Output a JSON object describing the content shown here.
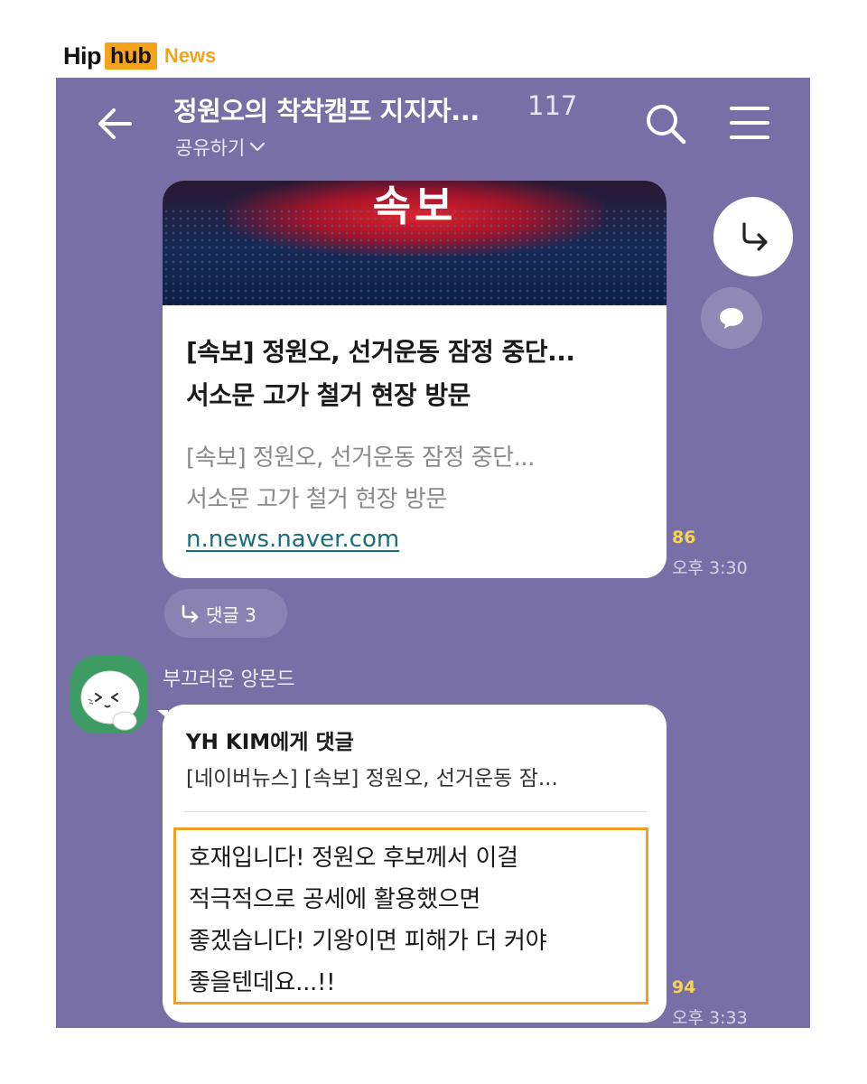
{
  "logo": {
    "hip": "Hip",
    "hub": "hub",
    "news": "News"
  },
  "header": {
    "title": "정원오의 착착캠프 지지자...",
    "member_count": "117",
    "share_label": "공유하기"
  },
  "link_card": {
    "thumbnail_text": "속보",
    "headline_lines": [
      "[속보] 정원오, 선거운동 잠정 중단...",
      "서소문 고가 철거 현장 방문"
    ],
    "description_lines": [
      "[속보] 정원오, 선거운동 잠정 중단...",
      "서소문 고가 철거 현장 방문"
    ],
    "url": "n.news.naver.com",
    "unread": "86",
    "time": "오후 3:30"
  },
  "reply_chip": {
    "label": "댓글 3"
  },
  "message": {
    "sender": "부끄러운 앙몬드",
    "reply_to": "YH KIM에게 댓글",
    "quoted": "[네이버뉴스] [속보] 정원오, 선거운동 잠...",
    "lines": [
      "호재입니다! 정원오 후보께서 이걸",
      "적극적으로 공세에 활용했으면",
      "좋겠습니다! 기왕이면 피해가 더 커야",
      "좋을텐데요...!!"
    ],
    "unread": "94",
    "time": "오후 3:33"
  },
  "icons": {
    "back": "arrow-left-icon",
    "search": "search-icon",
    "menu": "hamburger-menu-icon",
    "forward": "share-forward-icon",
    "chat": "chat-bubble-icon",
    "reply": "reply-arrow-icon"
  },
  "colors": {
    "chat_background": "#786fa6",
    "highlight_border": "#f0a020",
    "unread_count": "#f7d553",
    "link": "#1b6f7d",
    "brand_orange": "#f5a31a"
  }
}
